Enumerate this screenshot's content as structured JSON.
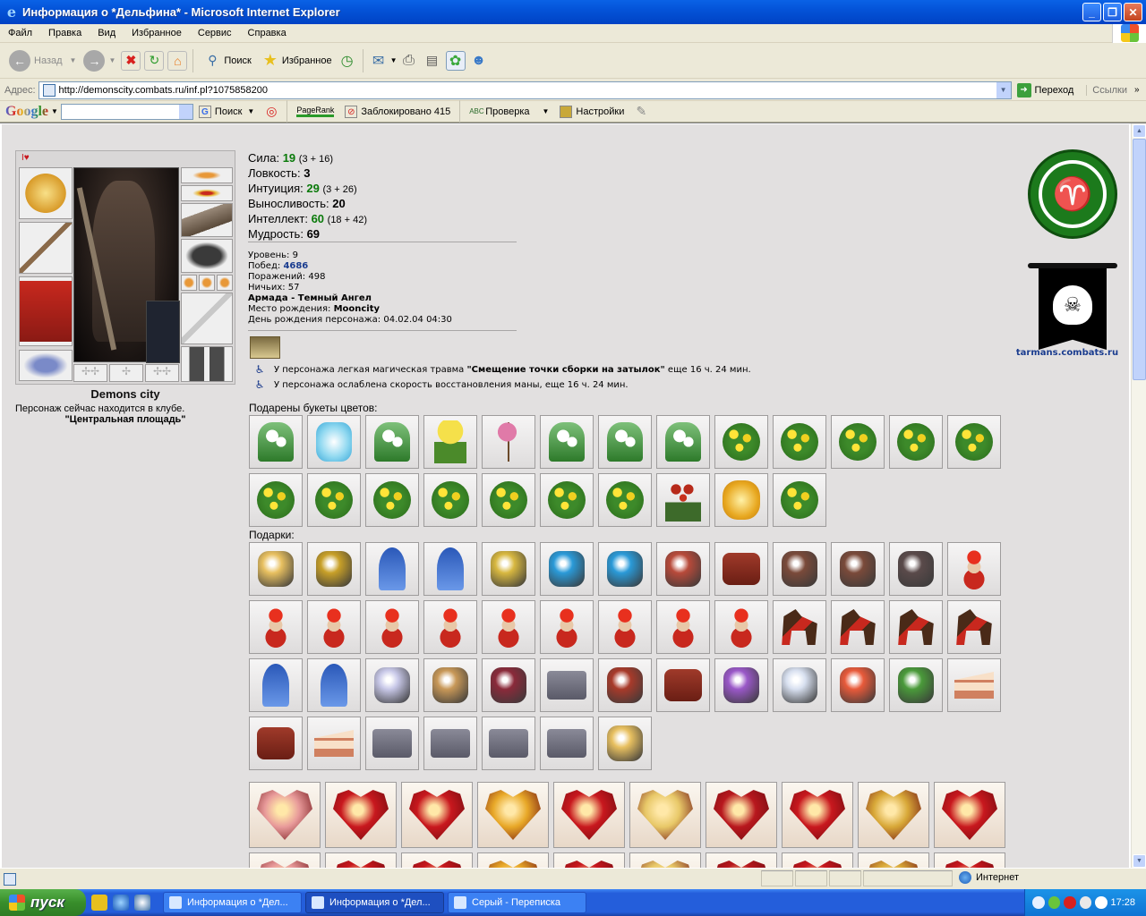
{
  "window": {
    "title": "Информация о *Дельфина* - Microsoft Internet Explorer"
  },
  "menu": [
    "Файл",
    "Правка",
    "Вид",
    "Избранное",
    "Сервис",
    "Справка"
  ],
  "toolbar": {
    "back": "Назад",
    "search": "Поиск",
    "favorites": "Избранное"
  },
  "address": {
    "label": "Адрес:",
    "url": "http://demonscity.combats.ru/inf.pl?1075858200",
    "go": "Переход",
    "links": "Ссылки"
  },
  "google": {
    "logo": "Google",
    "search": "Поиск",
    "pagerank": "PageRank",
    "blocked": "Заблокировано 415",
    "spell": "Проверка",
    "settings": "Настройки"
  },
  "character": {
    "city": "Demons city",
    "location_text": "Персонаж сейчас находится в клубе.",
    "location_place": "\"Центральная площадь\""
  },
  "stats": [
    {
      "label": "Сила:",
      "value": "19",
      "extra": "(3 + 16)",
      "boosted": true
    },
    {
      "label": "Ловкость:",
      "value": "3",
      "extra": "",
      "boosted": false
    },
    {
      "label": "Интуиция:",
      "value": "29",
      "extra": "(3 + 26)",
      "boosted": true
    },
    {
      "label": "Выносливость:",
      "value": "20",
      "extra": "",
      "boosted": false
    },
    {
      "label": "Интеллект:",
      "value": "60",
      "extra": "(18 + 42)",
      "boosted": true
    },
    {
      "label": "Мудрость:",
      "value": "69",
      "extra": "",
      "boosted": false
    }
  ],
  "info": {
    "level": "Уровень: 9",
    "wins_label": "Побед:",
    "wins": "4686",
    "losses": "Поражений: 498",
    "draws": "Ничьих: 57",
    "clan": "Армада - Темный Ангел",
    "birthplace_label": "Место рождения:",
    "birthplace": "Mooncity",
    "birthday": "День рождения персонажа: 04.02.04 04:30"
  },
  "effects": [
    {
      "before": "У персонажа легкая магическая травма ",
      "bold": "\"Смещение точки сборки на затылок\"",
      "after": " еще 16 ч. 24 мин."
    },
    {
      "before": "У персонажа ослаблена скорость восстановления маны, еще 16 ч. 24 мин.",
      "bold": "",
      "after": ""
    }
  ],
  "clan_site": "tarmans.combats.ru",
  "flowers_title": "Подарены букеты цветов:",
  "flowers": [
    "snow",
    "ice",
    "snow",
    "tulip",
    "magn",
    "snow",
    "snow",
    "snow",
    "flw",
    "flw",
    "flw",
    "flw",
    "flw",
    "flw",
    "flw",
    "flw",
    "flw",
    "flw",
    "flw",
    "flw",
    "rose",
    "gold",
    "flw"
  ],
  "gifts_title": "Подарки:",
  "gifts": [
    {
      "t": "misc",
      "c": "#e8c060"
    },
    {
      "t": "misc",
      "c": "#c8a028"
    },
    {
      "t": "doll",
      "c": ""
    },
    {
      "t": "doll",
      "c": ""
    },
    {
      "t": "misc",
      "c": "#d8b840"
    },
    {
      "t": "misc",
      "c": "#2a9ad8"
    },
    {
      "t": "misc",
      "c": "#2a9ad8"
    },
    {
      "t": "misc",
      "c": "#b84a3a"
    },
    {
      "t": "bag",
      "c": ""
    },
    {
      "t": "misc",
      "c": "#7a4a3a"
    },
    {
      "t": "misc",
      "c": "#7a4a3a"
    },
    {
      "t": "misc",
      "c": "#5a4a4a"
    },
    {
      "t": "bear",
      "c": ""
    },
    {
      "t": "bear",
      "c": ""
    },
    {
      "t": "bear",
      "c": ""
    },
    {
      "t": "bear",
      "c": ""
    },
    {
      "t": "bear",
      "c": ""
    },
    {
      "t": "bear",
      "c": ""
    },
    {
      "t": "bear",
      "c": ""
    },
    {
      "t": "bear",
      "c": ""
    },
    {
      "t": "bear",
      "c": ""
    },
    {
      "t": "bear",
      "c": ""
    },
    {
      "t": "horse",
      "c": ""
    },
    {
      "t": "horse",
      "c": ""
    },
    {
      "t": "horse",
      "c": ""
    },
    {
      "t": "horse",
      "c": ""
    },
    {
      "t": "doll",
      "c": ""
    },
    {
      "t": "doll",
      "c": ""
    },
    {
      "t": "misc",
      "c": "#c8c8e8"
    },
    {
      "t": "misc",
      "c": "#c89858"
    },
    {
      "t": "misc",
      "c": "#8a2a3a"
    },
    {
      "t": "box",
      "c": ""
    },
    {
      "t": "misc",
      "c": "#a83a2a"
    },
    {
      "t": "bag",
      "c": ""
    },
    {
      "t": "misc",
      "c": "#9a58c8"
    },
    {
      "t": "misc",
      "c": "#d8e0f0"
    },
    {
      "t": "misc",
      "c": "#e85a3a"
    },
    {
      "t": "misc",
      "c": "#4a9a3a"
    },
    {
      "t": "cake",
      "c": ""
    },
    {
      "t": "bag",
      "c": ""
    },
    {
      "t": "cake",
      "c": ""
    },
    {
      "t": "box",
      "c": ""
    },
    {
      "t": "box",
      "c": ""
    },
    {
      "t": "box",
      "c": ""
    },
    {
      "t": "box",
      "c": ""
    },
    {
      "t": "misc",
      "c": "#e8c060"
    }
  ],
  "valentines": [
    "#e89a9a",
    "#c8181e",
    "#c8181e",
    "#e8a828",
    "#c8181e",
    "#e8c868",
    "#b8181e",
    "#c8181e",
    "#d8a838",
    "#c8181e"
  ],
  "status": {
    "zone": "Интернет"
  },
  "taskbar": {
    "start": "пуск",
    "tasks": [
      "Информация о *Дел...",
      "Информация о *Дел...",
      "Серый - Переписка"
    ],
    "clock": "17:28"
  }
}
